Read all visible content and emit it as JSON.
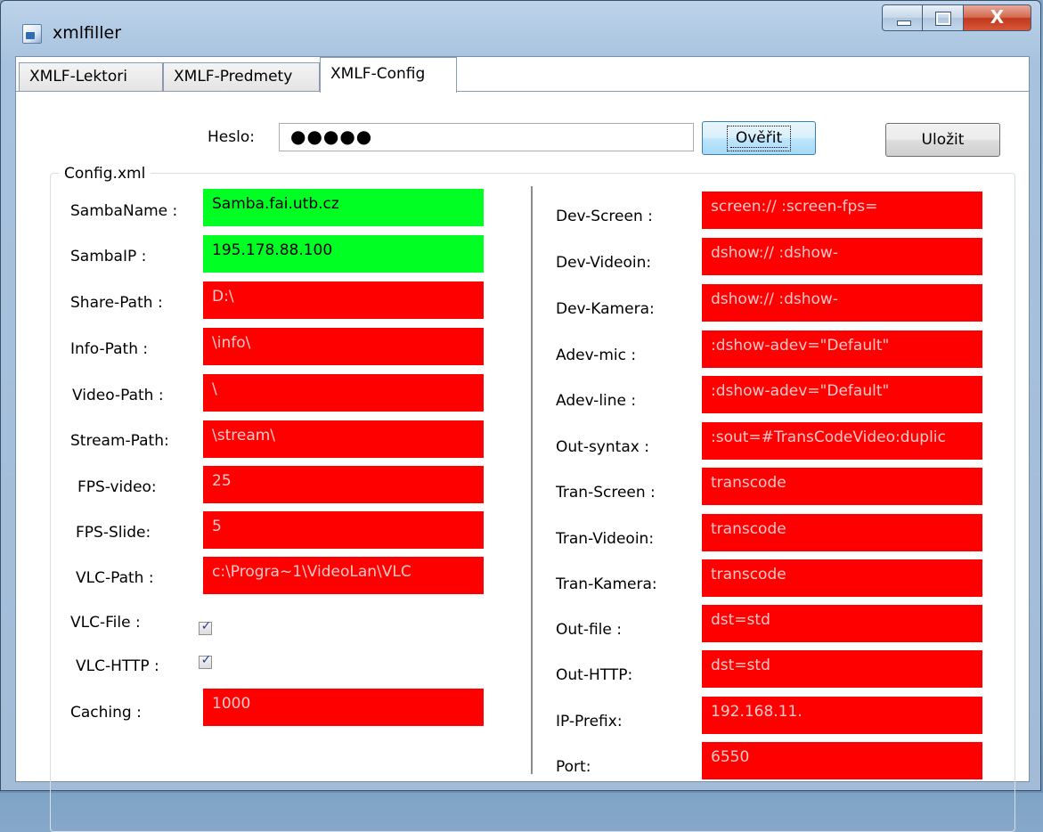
{
  "window": {
    "title": "xmlfiller",
    "close_glyph": "X"
  },
  "tabs": [
    {
      "label": "XMLF-Lektori"
    },
    {
      "label": "XMLF-Predmety"
    },
    {
      "label": "XMLF-Config"
    }
  ],
  "active_tab": "XMLF-Config",
  "password": {
    "label": "Heslo:",
    "value": "●●●●●"
  },
  "buttons": {
    "verify": "Ověřit",
    "save": "Uložit"
  },
  "group_title": "Config.xml",
  "colors": {
    "valid": "#00ff22",
    "invalid": "#ff0000"
  },
  "left_fields": [
    {
      "label": "SambaName :",
      "value": "Samba.fai.utb.cz",
      "status": "valid"
    },
    {
      "label": "SambaIP :",
      "value": "195.178.88.100",
      "status": "valid"
    },
    {
      "label": "Share-Path :",
      "value": "D:\\",
      "status": "invalid"
    },
    {
      "label": "Info-Path :",
      "value": "\\info\\",
      "status": "invalid"
    },
    {
      "label": "Video-Path :",
      "value": "\\",
      "status": "invalid"
    },
    {
      "label": "Stream-Path:",
      "value": "\\stream\\",
      "status": "invalid"
    },
    {
      "label": "FPS-video:",
      "value": "25",
      "status": "invalid"
    },
    {
      "label": "FPS-Slide:",
      "value": "5",
      "status": "invalid"
    },
    {
      "label": "VLC-Path :",
      "value": "c:\\Progra~1\\VideoLan\\VLC",
      "status": "invalid"
    }
  ],
  "checkboxes": [
    {
      "label": "VLC-File :",
      "checked": true,
      "glyph": "✓"
    },
    {
      "label": "VLC-HTTP :",
      "checked": true,
      "glyph": "✓"
    }
  ],
  "caching": {
    "label": "Caching :",
    "value": "1000",
    "status": "invalid"
  },
  "right_fields": [
    {
      "label": "Dev-Screen :",
      "value": "screen:// :screen-fps=",
      "status": "invalid"
    },
    {
      "label": "Dev-Videoin:",
      "value": "dshow:// :dshow-",
      "status": "invalid"
    },
    {
      "label": "Dev-Kamera:",
      "value": "dshow:// :dshow-",
      "status": "invalid"
    },
    {
      "label": "Adev-mic :",
      "value": ":dshow-adev=\"Default\"",
      "status": "invalid"
    },
    {
      "label": "Adev-line :",
      "value": ":dshow-adev=\"Default\"",
      "status": "invalid"
    },
    {
      "label": "Out-syntax :",
      "value": ":sout=#TransCodeVideo:duplic",
      "status": "invalid"
    },
    {
      "label": "Tran-Screen :",
      "value": "transcode",
      "status": "invalid"
    },
    {
      "label": "Tran-Videoin:",
      "value": "transcode",
      "status": "invalid"
    },
    {
      "label": "Tran-Kamera:",
      "value": "transcode",
      "status": "invalid"
    },
    {
      "label": "Out-file :",
      "value": "dst=std",
      "status": "invalid"
    },
    {
      "label": "Out-HTTP:",
      "value": "dst=std",
      "status": "invalid"
    },
    {
      "label": "IP-Prefix:",
      "value": "192.168.11.",
      "status": "invalid"
    },
    {
      "label": "Port:",
      "value": "6550",
      "status": "invalid"
    }
  ]
}
